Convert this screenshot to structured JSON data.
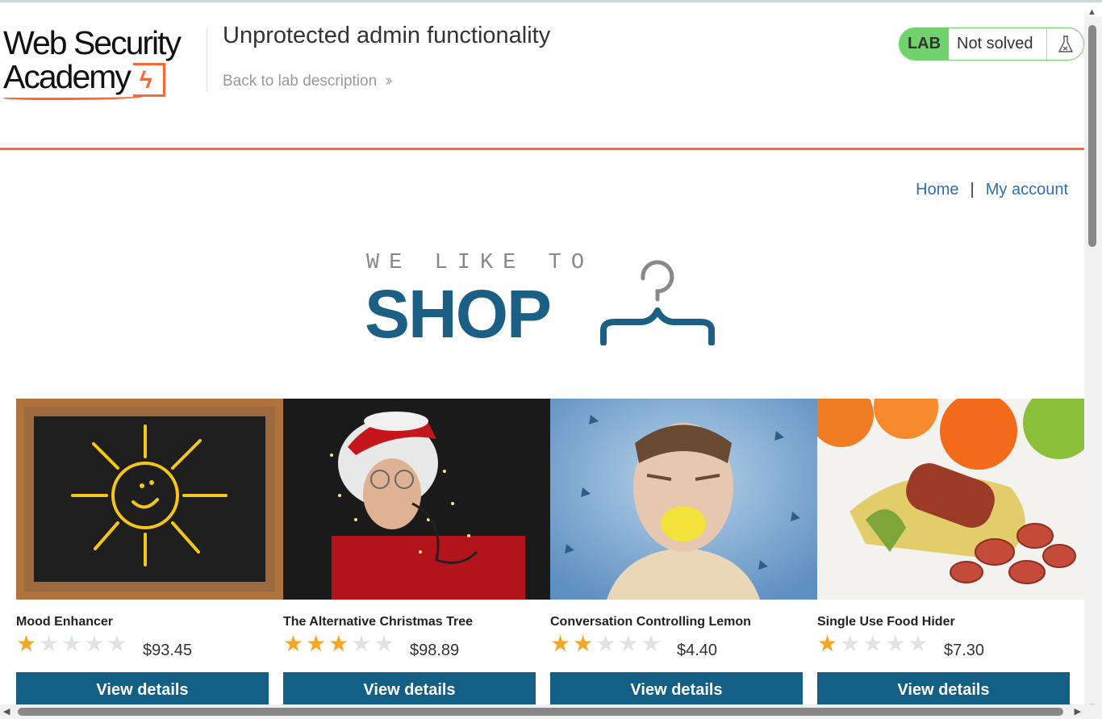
{
  "header": {
    "logo_line1": "Web Security",
    "logo_line2": "Academy",
    "lab_title": "Unprotected admin functionality",
    "back_link": "Back to lab description",
    "status_lab": "LAB",
    "status_state": "Not solved"
  },
  "nav": {
    "home": "Home",
    "separator": "|",
    "account": "My account"
  },
  "banner": {
    "line1": "WE LIKE TO",
    "line2": "SHOP"
  },
  "products": [
    {
      "name": "Mood Enhancer",
      "rating": 1,
      "price": "$93.45",
      "button": "View details",
      "image_desc": "sun-chalkboard-image"
    },
    {
      "name": "The Alternative Christmas Tree",
      "rating": 3,
      "price": "$98.89",
      "button": "View details",
      "image_desc": "christmas-lights-man-image"
    },
    {
      "name": "Conversation Controlling Lemon",
      "rating": 2,
      "price": "$4.40",
      "button": "View details",
      "image_desc": "lemon-mouth-man-image"
    },
    {
      "name": "Single Use Food Hider",
      "rating": 1,
      "price": "$7.30",
      "button": "View details",
      "image_desc": "banana-sausage-image"
    }
  ],
  "colors": {
    "accent_orange": "#ff6633",
    "lab_green": "#70d16d",
    "primary_blue": "#145f85",
    "link_blue": "#2e6fb3",
    "star_gold": "#f5a623"
  }
}
